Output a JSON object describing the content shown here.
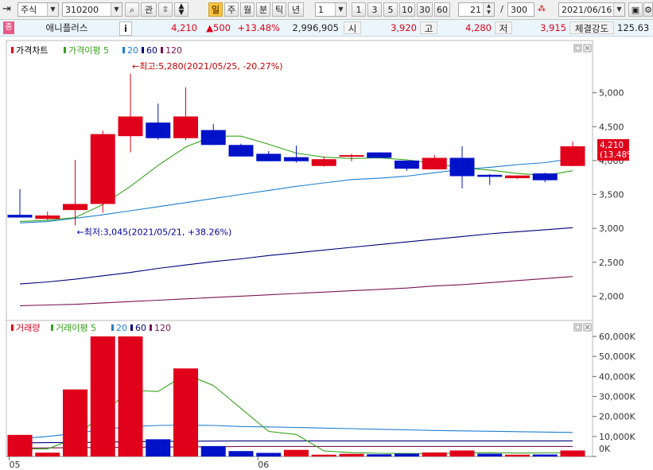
{
  "toolbar": {
    "market": "주식",
    "code": "310200",
    "watch_label": "관",
    "periods": [
      "일",
      "주",
      "월",
      "분",
      "틱",
      "년"
    ],
    "active_period": "일",
    "interval_value": "1",
    "quick_counts": [
      "1",
      "3",
      "5",
      "10",
      "30",
      "60"
    ],
    "range_value": "21",
    "range_separator": "/",
    "range_total": "300",
    "date": "2021/06/16"
  },
  "quote": {
    "badge": "종",
    "name": "애니플러스",
    "info_icon": "i",
    "price": "4,210",
    "change": "▲500",
    "change_pct": "+13.48%",
    "volume": "2,996,905",
    "open_label": "시",
    "open": "3,920",
    "high_label": "고",
    "high": "4,280",
    "low_label": "저",
    "low": "3,915",
    "strength_label": "체결강도",
    "strength": "125.63"
  },
  "colors": {
    "up": "#e0001a",
    "down": "#0012c8",
    "ma5": "#36a31c",
    "ma20": "#1e7fd0",
    "ma60": "#00007a",
    "ma120": "#7a1450",
    "background": "#ffffff",
    "grid": "#cccccc"
  },
  "chart_data": [
    {
      "type": "candlestick",
      "legend_title": "가격차트",
      "legend": [
        {
          "name": "가격이평 5",
          "color": "#36a31c"
        },
        {
          "name": "20",
          "color": "#1e7fd0"
        },
        {
          "name": "60",
          "color": "#00007a"
        },
        {
          "name": "120",
          "color": "#7a1450"
        }
      ],
      "x_ticks": [
        {
          "index": 0,
          "label": "05"
        },
        {
          "index": 9,
          "label": "06"
        }
      ],
      "y_ticks": [
        "5,000",
        "4,500",
        "4,000",
        "3,500",
        "3,000",
        "2,500",
        "2,000"
      ],
      "y_tick_values": [
        5000,
        4500,
        4000,
        3500,
        3000,
        2500,
        2000
      ],
      "ylim": [
        1700,
        5500
      ],
      "candles": [
        {
          "o": 3200,
          "h": 3580,
          "l": 3160,
          "c": 3160
        },
        {
          "o": 3140,
          "h": 3250,
          "l": 3120,
          "c": 3190
        },
        {
          "o": 3270,
          "h": 4010,
          "l": 3045,
          "c": 3360
        },
        {
          "o": 3360,
          "h": 4440,
          "l": 3230,
          "c": 4390
        },
        {
          "o": 4360,
          "h": 5280,
          "l": 4120,
          "c": 4650
        },
        {
          "o": 4560,
          "h": 4840,
          "l": 4310,
          "c": 4330
        },
        {
          "o": 4330,
          "h": 5080,
          "l": 4300,
          "c": 4650
        },
        {
          "o": 4450,
          "h": 4540,
          "l": 4230,
          "c": 4230
        },
        {
          "o": 4230,
          "h": 4250,
          "l": 4060,
          "c": 4060
        },
        {
          "o": 4100,
          "h": 4140,
          "l": 3990,
          "c": 3990
        },
        {
          "o": 4050,
          "h": 4220,
          "l": 3970,
          "c": 3990
        },
        {
          "o": 3920,
          "h": 4060,
          "l": 3910,
          "c": 4020
        },
        {
          "o": 4070,
          "h": 4100,
          "l": 3990,
          "c": 4080
        },
        {
          "o": 4120,
          "h": 4120,
          "l": 4040,
          "c": 4040
        },
        {
          "o": 4000,
          "h": 4000,
          "l": 3850,
          "c": 3880
        },
        {
          "o": 3870,
          "h": 4080,
          "l": 3880,
          "c": 4040
        },
        {
          "o": 4040,
          "h": 4210,
          "l": 3590,
          "c": 3770
        },
        {
          "o": 3790,
          "h": 3800,
          "l": 3640,
          "c": 3760
        },
        {
          "o": 3740,
          "h": 3780,
          "l": 3730,
          "c": 3780
        },
        {
          "o": 3810,
          "h": 3820,
          "l": 3680,
          "c": 3710
        },
        {
          "o": 3920,
          "h": 4280,
          "l": 3915,
          "c": 4210
        }
      ],
      "ma5": [
        3100,
        3120,
        3160,
        3350,
        3620,
        3930,
        4200,
        4360,
        4360,
        4240,
        4110,
        4050,
        4030,
        4040,
        4010,
        3960,
        3890,
        3860,
        3810,
        3780,
        3850
      ],
      "ma20": [
        3080,
        3100,
        3150,
        3200,
        3260,
        3320,
        3380,
        3440,
        3500,
        3560,
        3620,
        3670,
        3720,
        3740,
        3770,
        3820,
        3870,
        3900,
        3940,
        3970,
        4030
      ],
      "ma60": [
        2180,
        2210,
        2250,
        2300,
        2350,
        2410,
        2460,
        2510,
        2550,
        2600,
        2640,
        2680,
        2720,
        2760,
        2800,
        2840,
        2880,
        2920,
        2950,
        2980,
        3010
      ],
      "ma120": [
        1860,
        1870,
        1880,
        1900,
        1920,
        1940,
        1960,
        1980,
        2000,
        2020,
        2040,
        2060,
        2080,
        2100,
        2120,
        2150,
        2170,
        2200,
        2230,
        2260,
        2290
      ],
      "annotations": {
        "high_label": "←최고:5,280(2021/05/25, -20.27%)",
        "low_label": "←최저:3,045(2021/05/21, +38.26%)",
        "high_index": 4,
        "high_value": 5280,
        "low_index": 2,
        "low_value": 3045
      },
      "last_price_label": "4,210",
      "last_pct_label": "(13.48%)",
      "last_price_value": 4210,
      "grid": false
    },
    {
      "type": "bar",
      "legend_title": "거래량",
      "legend": [
        {
          "name": "거래이평 5",
          "color": "#36a31c"
        },
        {
          "name": "20",
          "color": "#1e7fd0"
        },
        {
          "name": "60",
          "color": "#00007a"
        },
        {
          "name": "120",
          "color": "#7a1450"
        }
      ],
      "y_ticks": [
        "60,000K",
        "50,000K",
        "40,000K",
        "30,000K",
        "20,000K",
        "10,000K",
        "0K"
      ],
      "y_tick_values": [
        60000,
        50000,
        40000,
        30000,
        20000,
        10000,
        0
      ],
      "ylim": [
        0,
        62000
      ],
      "units": "K",
      "volumes": [
        10800,
        1900,
        33500,
        60000,
        60000,
        8600,
        44000,
        5200,
        2700,
        1800,
        3300,
        900,
        1300,
        1100,
        1400,
        2000,
        3000,
        1400,
        900,
        1000,
        3000
      ],
      "up": [
        true,
        true,
        true,
        true,
        true,
        false,
        true,
        false,
        false,
        false,
        true,
        true,
        true,
        false,
        false,
        true,
        true,
        false,
        true,
        false,
        true
      ],
      "vma5": [
        3800,
        3800,
        9000,
        22000,
        33000,
        32500,
        41000,
        35500,
        24000,
        12500,
        11000,
        2800,
        1900,
        1600,
        1500,
        1400,
        1700,
        1900,
        1700,
        1800,
        1800
      ],
      "vma20": [
        9000,
        10000,
        11500,
        13500,
        15000,
        15500,
        15700,
        15500,
        15000,
        14800,
        14500,
        14200,
        13900,
        13600,
        13300,
        13000,
        12800,
        12600,
        12400,
        12200,
        12000
      ],
      "vma60": [
        6800,
        6900,
        7000,
        7200,
        7400,
        7500,
        7600,
        7700,
        7800,
        7800,
        7800,
        7800,
        7800,
        7800,
        7800,
        7800,
        7800,
        7800,
        7800,
        7800,
        7800
      ],
      "vma120": [
        4200,
        4300,
        4400,
        4500,
        4600,
        4700,
        4800,
        4900,
        5000,
        5000,
        5000,
        5000,
        5000,
        5000,
        5000,
        5000,
        5000,
        5000,
        5000,
        5000,
        5000
      ]
    }
  ]
}
